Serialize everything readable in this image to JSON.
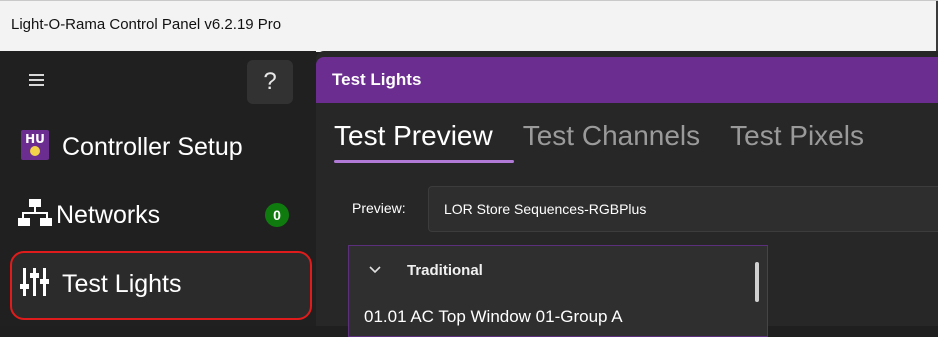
{
  "window": {
    "title": "Light-O-Rama Control Panel v6.2.19 Pro"
  },
  "sidebar": {
    "help_label": "?",
    "items": [
      {
        "label": "Controller Setup",
        "icon": "hu-icon"
      },
      {
        "label": "Networks",
        "icon": "network-icon",
        "badge": "0"
      },
      {
        "label": "Test Lights",
        "icon": "sliders-icon",
        "selected": true
      }
    ]
  },
  "main": {
    "header_title": "Test Lights",
    "tabs": [
      {
        "label": "Test Preview",
        "active": true
      },
      {
        "label": "Test Channels",
        "active": false
      },
      {
        "label": "Test Pixels",
        "active": false
      }
    ],
    "preview": {
      "label": "Preview:",
      "value": "LOR Store Sequences-RGBPlus"
    },
    "list": {
      "group_label": "Traditional",
      "items": [
        "01.01 AC Top Window 01-Group A"
      ]
    }
  },
  "colors": {
    "accent": "#6b2d8f",
    "selection_outline": "#e01b1b",
    "badge": "#0f7b0f"
  }
}
